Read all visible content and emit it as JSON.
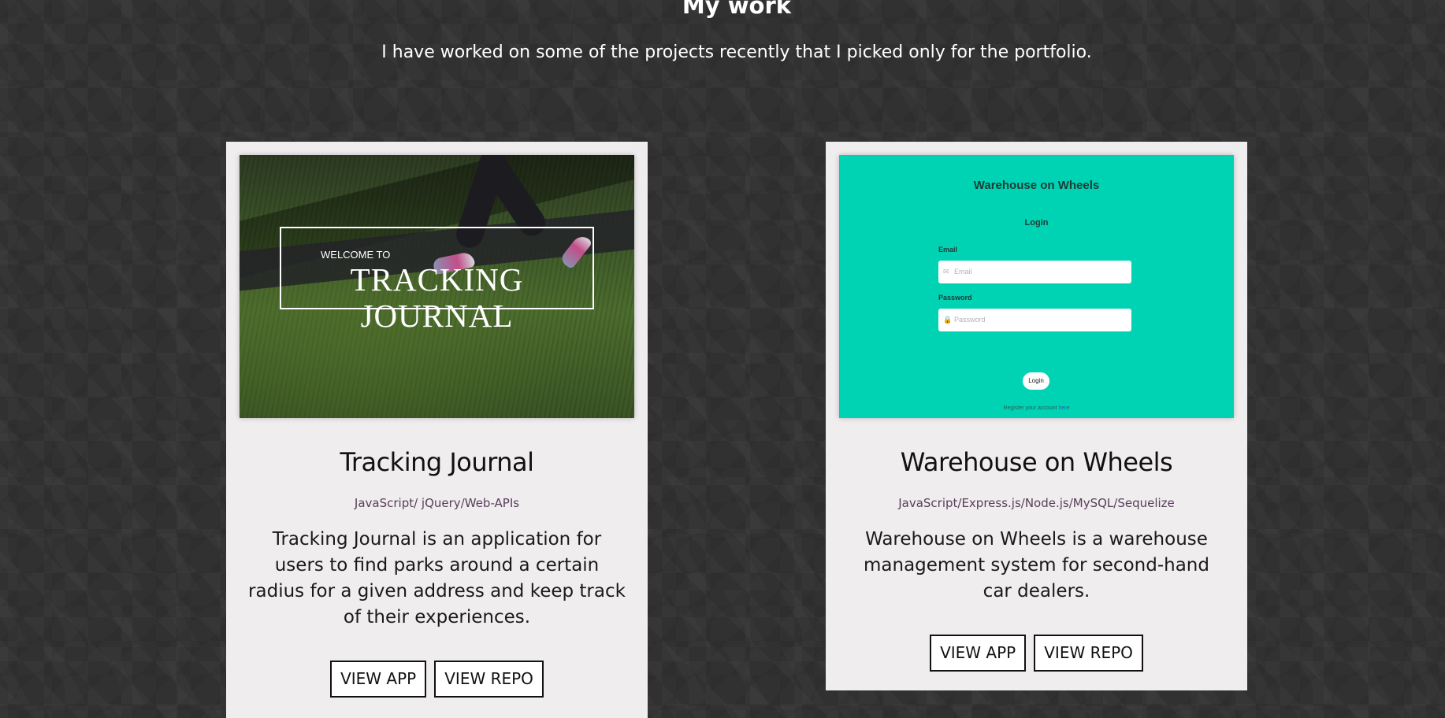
{
  "section": {
    "title": "My work",
    "subtitle": "I have worked on some of the projects recently that I picked only for the portfolio."
  },
  "projects": [
    {
      "title": "Tracking Journal",
      "tech": "JavaScript/ jQuery/Web-APIs",
      "description": "Tracking Journal is an application for users to find parks around a certain radius for a given address and keep track of their experiences.",
      "view_app_label": "VIEW APP",
      "view_repo_label": "VIEW REPO",
      "thumbnail": {
        "welcome_text": "WELCOME TO",
        "brand_text": "TRACKING JOURNAL"
      }
    },
    {
      "title": "Warehouse on Wheels",
      "tech": "JavaScript/Express.js/Node.js/MySQL/Sequelize",
      "description": "Warehouse on Wheels is a warehouse management system for second-hand car dealers.",
      "view_app_label": "VIEW APP",
      "view_repo_label": "VIEW REPO",
      "thumbnail": {
        "app_title": "Warehouse on Wheels",
        "login_heading": "Login",
        "email_label": "Email",
        "email_placeholder": "Email",
        "password_label": "Password",
        "password_placeholder": "Password",
        "login_button": "Login",
        "register_text": "Register your account",
        "register_link": "here"
      }
    }
  ],
  "colors": {
    "background": "#313131",
    "card": "#efedee",
    "tech_text": "#5a3d5c",
    "warehouse_thumb": "#00d2b4"
  }
}
